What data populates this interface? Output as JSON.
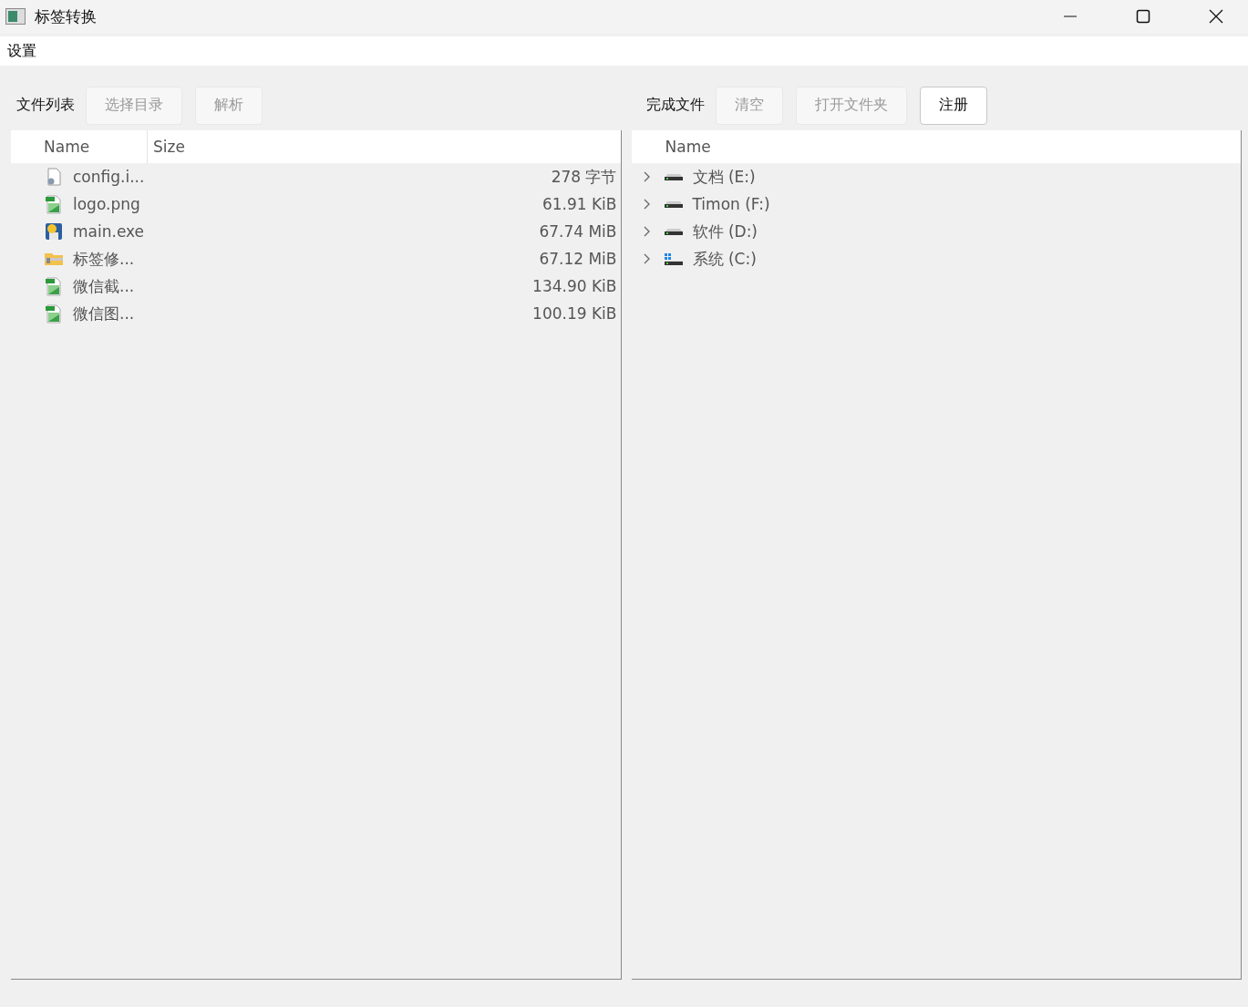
{
  "window": {
    "title": "标签转换"
  },
  "menu": [
    "设置"
  ],
  "left": {
    "label": "文件列表",
    "buttons": [
      {
        "label": "选择目录",
        "disabled": true
      },
      {
        "label": "解析",
        "disabled": true
      }
    ],
    "columns": [
      "Name",
      "Size"
    ],
    "files": [
      {
        "name": "config.i...",
        "size": "278 字节",
        "kind": "config"
      },
      {
        "name": "logo.png",
        "size": "61.91 KiB",
        "kind": "image"
      },
      {
        "name": "main.exe",
        "size": "67.74 MiB",
        "kind": "program"
      },
      {
        "name": "标签修...",
        "size": "67.12 MiB",
        "kind": "archive"
      },
      {
        "name": "微信截...",
        "size": "134.90 KiB",
        "kind": "image"
      },
      {
        "name": "微信图...",
        "size": "100.19 KiB",
        "kind": "image"
      }
    ]
  },
  "right": {
    "label": "完成文件",
    "buttons": [
      {
        "label": "清空",
        "disabled": true
      },
      {
        "label": "打开文件夹",
        "disabled": true
      },
      {
        "label": "注册",
        "disabled": false
      }
    ],
    "columns": [
      "Name"
    ],
    "drives": [
      {
        "name": "文档 (E:)",
        "kind": "drive",
        "expanded": false
      },
      {
        "name": "Timon (F:)",
        "kind": "drive",
        "expanded": false
      },
      {
        "name": "软件 (D:)",
        "kind": "drive",
        "expanded": false
      },
      {
        "name": "系统 (C:)",
        "kind": "system",
        "expanded": false
      }
    ]
  }
}
